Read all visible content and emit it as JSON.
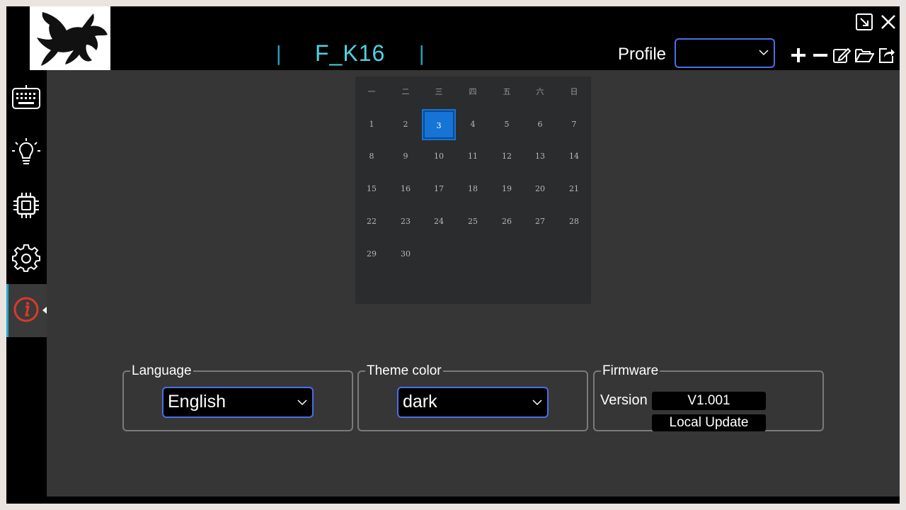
{
  "header": {
    "device_name": "F_K16",
    "separator": "|",
    "profile_label": "Profile",
    "profile_value": ""
  },
  "toolbar": {
    "icons": [
      "plus-icon",
      "minus-icon",
      "edit-icon",
      "folder-open-icon",
      "export-icon"
    ]
  },
  "window_controls": {
    "icons": [
      "restore-icon",
      "close-icon"
    ]
  },
  "sidebar": {
    "items": [
      {
        "icon": "keyboard-icon"
      },
      {
        "icon": "light-bulb-icon"
      },
      {
        "icon": "chip-icon"
      },
      {
        "icon": "gear-icon"
      },
      {
        "icon": "info-icon",
        "active": true
      }
    ]
  },
  "calendar": {
    "weekdays": [
      "一",
      "二",
      "三",
      "四",
      "五",
      "六",
      "日"
    ],
    "days": [
      "1",
      "2",
      "3",
      "4",
      "5",
      "6",
      "7",
      "8",
      "9",
      "10",
      "11",
      "12",
      "13",
      "14",
      "15",
      "16",
      "17",
      "18",
      "19",
      "20",
      "21",
      "22",
      "23",
      "24",
      "25",
      "26",
      "27",
      "28",
      "29",
      "30"
    ],
    "selected_day": "3"
  },
  "settings": {
    "language": {
      "legend": "Language",
      "value": "English"
    },
    "theme": {
      "legend": "Theme color",
      "value": "dark"
    },
    "firmware": {
      "legend": "Firmware",
      "version_label": "Version",
      "version_value": "V1.001",
      "update_button": "Local Update"
    }
  },
  "colors": {
    "accent_cyan": "#4fd3e0",
    "focus_blue": "#4a6fe8",
    "selected_day": "#1674d6",
    "info_red": "#d93a2b"
  }
}
